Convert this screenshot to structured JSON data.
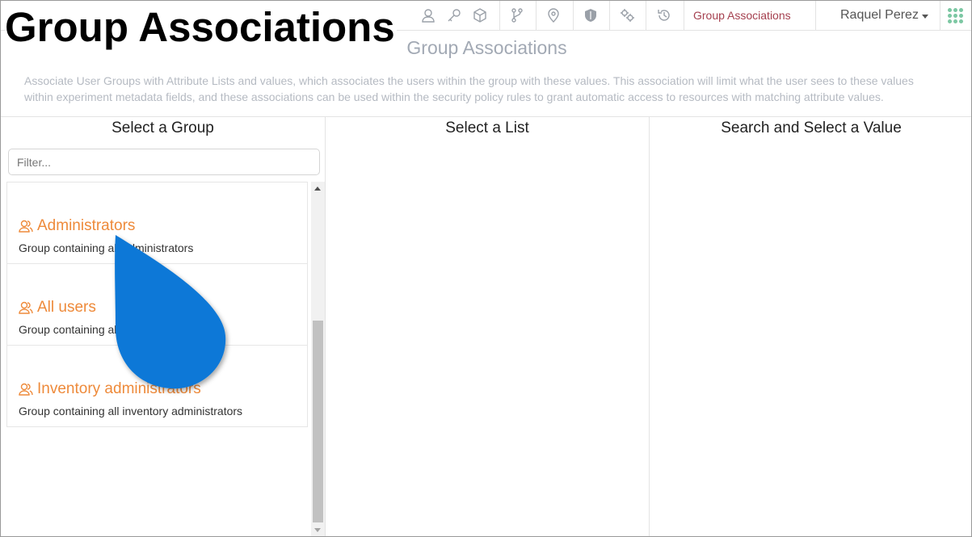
{
  "overlay_heading": "Group Associations",
  "navbar": {
    "icons": [
      "user-icon",
      "key-icon",
      "cube-icon",
      "branch-icon",
      "location-pin-icon",
      "shield-icon",
      "gears-icon",
      "history-icon"
    ],
    "active_item": "Group Associations",
    "user_name": "Raquel Perez",
    "apps_icon": "apps-grid-icon"
  },
  "page": {
    "title": "Group Associations",
    "description": "Associate User Groups with Attribute Lists and values, which associates the users within the group with these values. This association will limit what the user sees to these values within experiment metadata fields, and these associations can be used within the security policy rules to grant automatic access to resources with matching attribute values."
  },
  "columns": {
    "groups": {
      "title": "Select a Group",
      "filter_placeholder": "Filter...",
      "items": [
        {
          "name": "Administrators",
          "description": "Group containing all administrators"
        },
        {
          "name": "All users",
          "description": "Group containing all users"
        },
        {
          "name": "Inventory administrators",
          "description": "Group containing all inventory administrators"
        }
      ]
    },
    "lists": {
      "title": "Select a List"
    },
    "values": {
      "title": "Search and Select a Value"
    }
  },
  "colors": {
    "accent_orange": "#ee8a3a",
    "active_nav": "#a5404f",
    "cursor_blue": "#0a78d7"
  }
}
